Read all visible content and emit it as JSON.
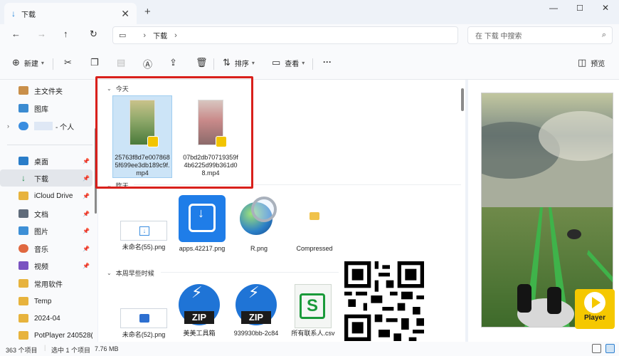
{
  "tab": {
    "title": "下载"
  },
  "address": {
    "segment": "下载"
  },
  "search": {
    "placeholder": "在 下载 中搜索"
  },
  "toolbar": {
    "new_label": "新建",
    "sort_label": "排序",
    "view_label": "查看",
    "more_label": "···",
    "preview_label": "预览"
  },
  "sidebar": {
    "items": [
      {
        "label": "主文件夹"
      },
      {
        "label": "图库"
      },
      {
        "label": "- 个人"
      },
      {
        "label": "桌面"
      },
      {
        "label": "下载"
      },
      {
        "label": "iCloud Drive"
      },
      {
        "label": "文档"
      },
      {
        "label": "图片"
      },
      {
        "label": "音乐"
      },
      {
        "label": "视频"
      },
      {
        "label": "常用软件"
      },
      {
        "label": "Temp"
      },
      {
        "label": "2024-04"
      },
      {
        "label": "PotPlayer 240528(1"
      }
    ]
  },
  "groups": {
    "today": "今天",
    "yesterday": "昨天",
    "earlier_week": "本周早些时候"
  },
  "files": {
    "today": [
      {
        "name": "25763f8d7e0078685f699ee3db189c9f.mp4"
      },
      {
        "name": "07bd2db70719359f4b6225d99b361d08.mp4"
      }
    ],
    "yesterday": [
      {
        "name": "未命名(55).png"
      },
      {
        "name": "apps.42217.png"
      },
      {
        "name": "R.png"
      },
      {
        "name": "Compressed"
      }
    ],
    "earlier": [
      {
        "name": "未命名(52).png"
      },
      {
        "name": "美美工具箱"
      },
      {
        "name": "939930bb-2c84"
      },
      {
        "name": "所有联系人.csv"
      }
    ]
  },
  "icons": {
    "zip_text": "ZIP",
    "player_text": "Player"
  },
  "status": {
    "count": "363 个项目",
    "selected": "选中 1 个项目",
    "size": "7.76 MB"
  }
}
